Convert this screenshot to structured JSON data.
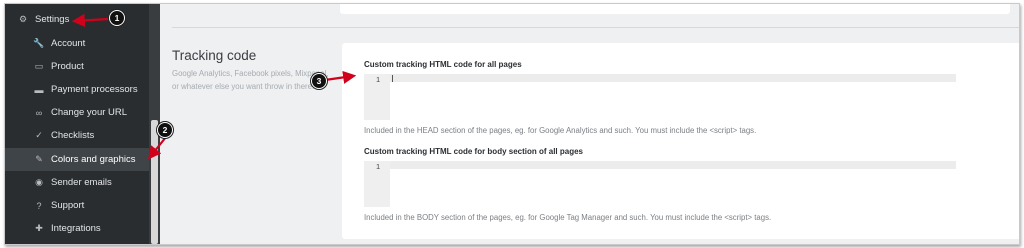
{
  "sidebar": {
    "items": [
      {
        "label": "Settings",
        "icon": "gears-icon",
        "glyph": "⚙",
        "level": "top",
        "active": false
      },
      {
        "label": "Account",
        "icon": "wrench-icon",
        "glyph": "🔧",
        "level": "sub",
        "active": false
      },
      {
        "label": "Product",
        "icon": "product-box-icon",
        "glyph": "▭",
        "level": "sub",
        "active": false
      },
      {
        "label": "Payment processors",
        "icon": "credit-card-icon",
        "glyph": "▬",
        "level": "sub",
        "active": false
      },
      {
        "label": "Change your URL",
        "icon": "link-icon",
        "glyph": "∞",
        "level": "sub",
        "active": false
      },
      {
        "label": "Checklists",
        "icon": "checkmark-icon",
        "glyph": "✓",
        "level": "sub",
        "active": false
      },
      {
        "label": "Colors and graphics",
        "icon": "paintbrush-icon",
        "glyph": "✎",
        "level": "sub",
        "active": true
      },
      {
        "label": "Sender emails",
        "icon": "globe-icon",
        "glyph": "◉",
        "level": "sub",
        "active": false
      },
      {
        "label": "Support",
        "icon": "question-icon",
        "glyph": "?",
        "level": "sub",
        "active": false
      },
      {
        "label": "Integrations",
        "icon": "puzzle-icon",
        "glyph": "✚",
        "level": "sub",
        "active": false
      }
    ]
  },
  "section": {
    "title": "Tracking code",
    "description": "Google Analytics, Facebook pixels, Mixpanel, or whatever else you want throw in there."
  },
  "head_code": {
    "label": "Custom tracking HTML code for all pages",
    "line_number": "1",
    "help": "Included in the HEAD section of the pages, eg. for Google Analytics and such. You must include the <script> tags."
  },
  "body_code": {
    "label": "Custom tracking HTML code for body section of all pages",
    "line_number": "1",
    "help": "Included in the BODY section of the pages, eg. for Google Tag Manager and such. You must include the <script> tags."
  },
  "callouts": {
    "one": "1",
    "two": "2",
    "three": "3",
    "arrow_color": "#d0021b"
  },
  "colors": {
    "sidebar_bg": "#2a2d30",
    "sidebar_active": "#3f4448",
    "content_bg": "#eef0f2"
  }
}
